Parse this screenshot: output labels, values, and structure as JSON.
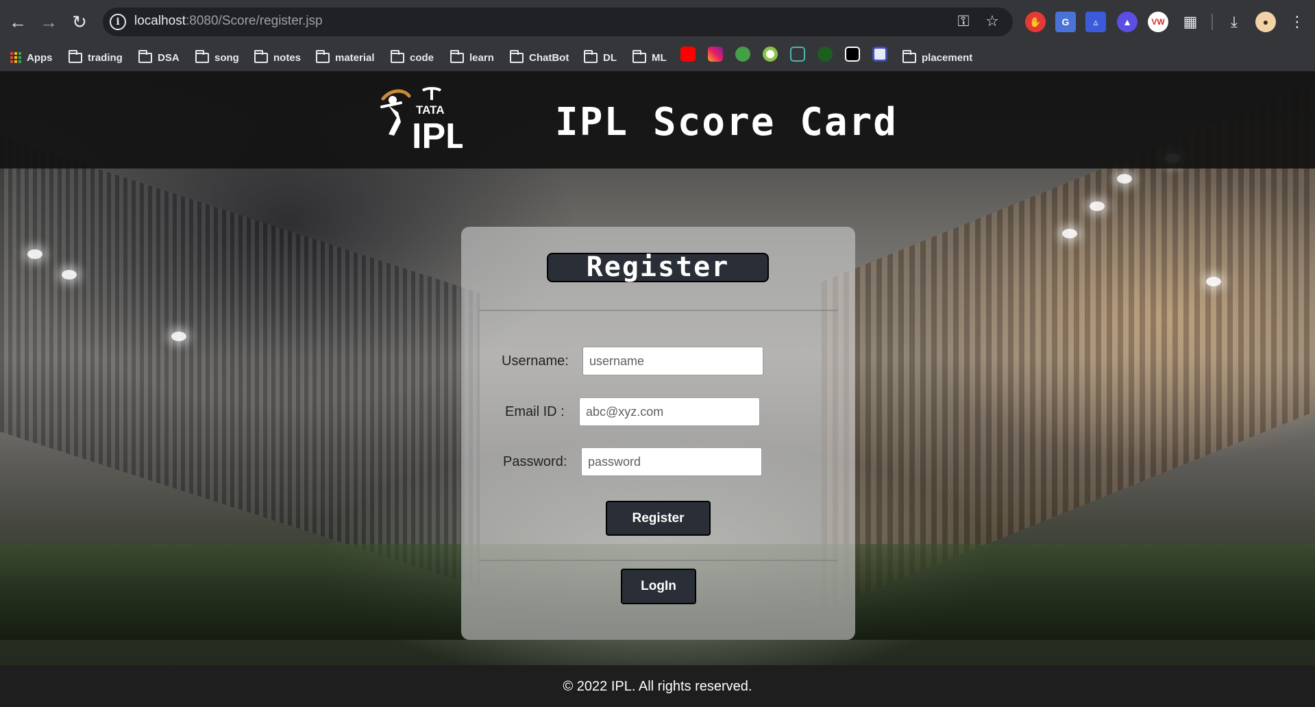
{
  "browser": {
    "url_host": "localhost",
    "url_rest": ":8080/Score/register.jsp",
    "bookmarks": [
      "Apps",
      "trading",
      "DSA",
      "song",
      "notes",
      "material",
      "code",
      "learn",
      "ChatBot",
      "DL",
      "ML",
      "placement"
    ],
    "icons": [
      "back-arrow-icon",
      "forward-arrow-icon",
      "reload-icon",
      "site-info-icon",
      "password-key-icon",
      "star-bookmark-icon",
      "extensions-puzzle-icon",
      "download-icon",
      "profile-avatar-icon",
      "more-vert-icon"
    ]
  },
  "header": {
    "logo_top_text": "TATA",
    "logo_main_text": "IPL",
    "title": "IPL Score Card"
  },
  "form": {
    "heading": "Register",
    "username_label": "Username:",
    "username_placeholder": "username",
    "email_label": "Email ID :",
    "email_placeholder": "abc@xyz.com",
    "password_label": "Password:",
    "password_placeholder": "password",
    "register_button": "Register",
    "login_button": "LogIn"
  },
  "footer": {
    "text": "© 2022 IPL. All rights reserved."
  },
  "colors": {
    "header_bg": "#121212",
    "button_bg": "#2a2e36",
    "card_bg": "#cdcdcd",
    "footer_bg": "#1e1e1e"
  }
}
